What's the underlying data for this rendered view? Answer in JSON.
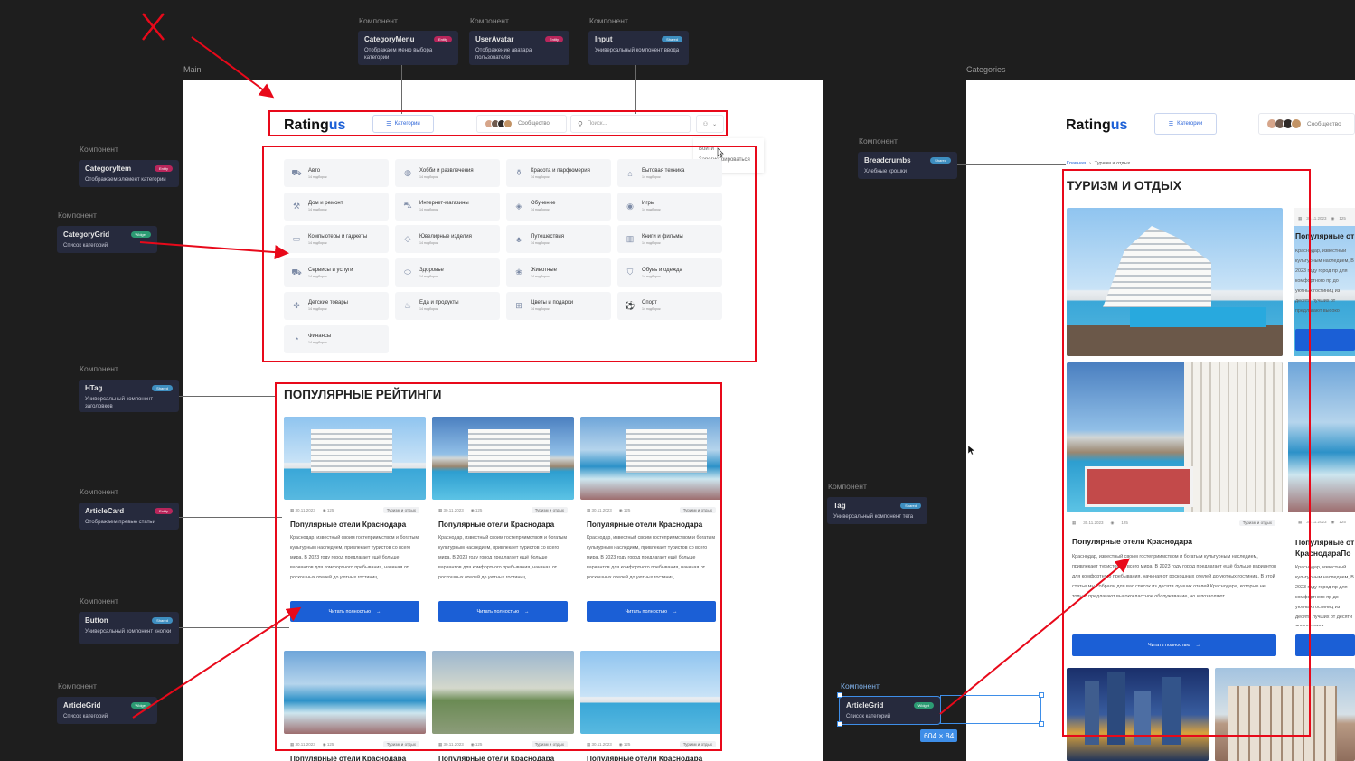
{
  "frames": {
    "main": "Main",
    "categories": "Categories"
  },
  "component_label": "Компонент",
  "badges": {
    "entity": "Entity",
    "shared": "Shared",
    "widget": "Widget"
  },
  "components": {
    "category_menu": {
      "name": "CategoryMenu",
      "desc": "Отображаем меню выбора категории"
    },
    "user_avatar": {
      "name": "UserAvatar",
      "desc": "Отображение аватара пользователя"
    },
    "input": {
      "name": "Input",
      "desc": "Универсальный компонент ввода"
    },
    "category_item": {
      "name": "CategoryItem",
      "desc": "Отображаем элемент категории"
    },
    "category_grid": {
      "name": "CategoryGrid",
      "desc": "Список категорий"
    },
    "htag": {
      "name": "HTag",
      "desc": "Универсальный компонент заголовков"
    },
    "article_card": {
      "name": "ArticleCard",
      "desc": "Отображаем превью статьи"
    },
    "button": {
      "name": "Button",
      "desc": "Универсальный компонент кнопки"
    },
    "article_grid": {
      "name": "ArticleGrid",
      "desc": "Список категорий"
    },
    "breadcrumbs": {
      "name": "Breadcrumbs",
      "desc": "Хлебные крошки"
    },
    "tag": {
      "name": "Tag",
      "desc": "Универсальный компонент тега"
    },
    "article_grid_right": {
      "name": "ArticleGrid",
      "desc": "Список категорий"
    }
  },
  "header": {
    "logo_main": "Rating",
    "logo_accent": "us",
    "categories_button": "Категории",
    "community": "Сообщество",
    "search_placeholder": "Поиск...",
    "dropdown_login": "Войти",
    "dropdown_register": "Зарегистрироваться"
  },
  "categories": [
    {
      "label": "Авто",
      "sub": "14 подборок",
      "icon": "car-icon",
      "glyph": "⛟"
    },
    {
      "label": "Хобби и развлечения",
      "sub": "14 подборок",
      "icon": "palette-icon",
      "glyph": "◍"
    },
    {
      "label": "Красота и парфюмерия",
      "sub": "14 подборок",
      "icon": "perfume-icon",
      "glyph": "⚱"
    },
    {
      "label": "Бытовая техника",
      "sub": "14 подборок",
      "icon": "appliance-icon",
      "glyph": "⌂"
    },
    {
      "label": "Дом и ремонт",
      "sub": "14 подборок",
      "icon": "wrench-icon",
      "glyph": "⚒"
    },
    {
      "label": "Интернет-магазины",
      "sub": "14 подборок",
      "icon": "cart-icon",
      "glyph": "⛍"
    },
    {
      "label": "Обучение",
      "sub": "14 подборок",
      "icon": "graduation-icon",
      "glyph": "◈"
    },
    {
      "label": "Игры",
      "sub": "14 подборок",
      "icon": "gamepad-icon",
      "glyph": "◉"
    },
    {
      "label": "Компьютеры и гаджеты",
      "sub": "14 подборок",
      "icon": "laptop-icon",
      "glyph": "▭"
    },
    {
      "label": "Ювелирные изделия",
      "sub": "14 подборок",
      "icon": "diamond-icon",
      "glyph": "◇"
    },
    {
      "label": "Путешествия",
      "sub": "14 подборок",
      "icon": "palm-icon",
      "glyph": "♣"
    },
    {
      "label": "Книги и фильмы",
      "sub": "14 подборок",
      "icon": "book-icon",
      "glyph": "▥"
    },
    {
      "label": "Сервисы и услуги",
      "sub": "14 подборок",
      "icon": "truck-icon",
      "glyph": "⛟"
    },
    {
      "label": "Здоровье",
      "sub": "14 подборок",
      "icon": "pill-icon",
      "glyph": "⬭"
    },
    {
      "label": "Животные",
      "sub": "14 подборок",
      "icon": "paw-icon",
      "glyph": "❀"
    },
    {
      "label": "Обувь и одежда",
      "sub": "14 подборок",
      "icon": "shirt-icon",
      "glyph": "⛉"
    },
    {
      "label": "Детские товары",
      "sub": "14 подборок",
      "icon": "puzzle-icon",
      "glyph": "✤"
    },
    {
      "label": "Еда и продукты",
      "sub": "14 подборок",
      "icon": "food-icon",
      "glyph": "♨"
    },
    {
      "label": "Цветы и подарки",
      "sub": "14 подборок",
      "icon": "gift-icon",
      "glyph": "⊞"
    },
    {
      "label": "Спорт",
      "sub": "14 подборок",
      "icon": "ball-icon",
      "glyph": "⚽"
    },
    {
      "label": "Финансы",
      "sub": "14 подборок",
      "icon": "piggy-bank-icon",
      "glyph": "◔"
    }
  ],
  "popular": {
    "title": "ПОПУЛЯРНЫЕ РЕЙТИНГИ",
    "cards": [
      {
        "date": "30.11.2023",
        "views": "125",
        "tag": "Туризм и отдых",
        "title": "Популярные отели Краснодара",
        "text": "Краснодар, известный своим гостеприимством и богатым культурным наследием, привлекает туристов со всего мира. В 2023 году город предлагает ещё больше вариантов для комфортного пребывания, начиная от роскошных отелей до уютных гостиниц...",
        "button": "Читать полностью"
      },
      {
        "date": "30.11.2023",
        "views": "125",
        "tag": "Туризм и отдых",
        "title": "Популярные отели Краснодара",
        "text": "Краснодар, известный своим гостеприимством и богатым культурным наследием, привлекает туристов со всего мира. В 2023 году город предлагает ещё больше вариантов для комфортного пребывания, начиная от роскошных отелей до уютных гостиниц...",
        "button": "Читать полностью"
      },
      {
        "date": "30.11.2023",
        "views": "125",
        "tag": "Туризм и отдых",
        "title": "Популярные отели Краснодара",
        "text": "Краснодар, известный своим гостеприимством и богатым культурным наследием, привлекает туристов со всего мира. В 2023 году город предлагает ещё больше вариантов для комфортного пребывания, начиная от роскошных отелей до уютных гостиниц...",
        "button": "Читать полностью"
      }
    ],
    "row2": [
      {
        "date": "30.11.2023",
        "views": "125",
        "tag": "Туризм и отдых",
        "title": "Популярные отели Краснодара"
      },
      {
        "date": "30.11.2023",
        "views": "125",
        "tag": "Туризм и отдых",
        "title": "Популярные отели Краснодара"
      },
      {
        "date": "30.11.2023",
        "views": "125",
        "tag": "Туризм и отдых",
        "title": "Популярные отели Краснодара"
      }
    ]
  },
  "categories_page": {
    "breadcrumb_home": "Главная",
    "breadcrumb_current": "Туризм и отдых",
    "title": "ТУРИЗМ И ОТДЫХ",
    "card_top_meta_date": "30.11.2023",
    "card_top_meta_views": "125",
    "peek_title": "Популярные от",
    "peek_title_2": "Популярные от",
    "peek_title_3": "КраснодараПо",
    "main_card": {
      "date": "30.11.2023",
      "views": "125",
      "tag": "Туризм и отдых",
      "title": "Популярные отели Краснодара",
      "text": "Краснодар, известный своим гостеприимством и богатым культурным наследием, привлекает туристов со всего мира. В 2023 году город предлагает ещё больше вариантов для комфортного пребывания, начиная от роскошных отелей до уютных гостиниц. В этой статье мы собрали для вас список из десяти лучших отелей Краснодара, которые не только предлагают высококлассное обслуживание, но и позволяют...",
      "button": "Читать полностью"
    },
    "peek_text_1": "Краснодар, известный культурным наследием, В 2023 году город пр для комфортного пр до уютных гостиниц из десяти лучших от предлагают высоко",
    "peek_text_2": "Краснодар, известный культурным наследием, В 2023 году город пр для комфортного пр до уютных гостиниц из десяти лучших от десяти лучших отел"
  },
  "selection_size": "604 × 84"
}
